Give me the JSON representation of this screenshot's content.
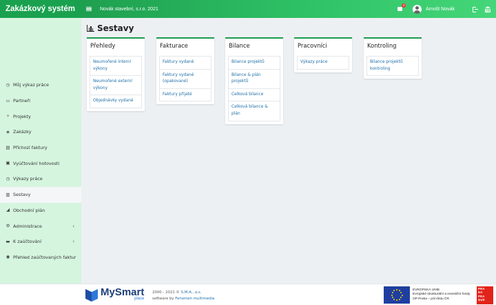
{
  "app": {
    "title": "Zakázkový systém",
    "company": "Novák stavební, s.r.o. 2021",
    "user": "Arnošt Novák",
    "notification_count": "4"
  },
  "colors": {
    "brand_green": "#1aa14f",
    "sidebar_bg": "#d5f5df",
    "link_blue": "#1e6fa8"
  },
  "icons": {
    "menu": "hamburger-icon",
    "notifications": "inbox-icon",
    "logout": "logout-icon",
    "home": "bank-icon"
  },
  "sidebar": {
    "items": [
      {
        "label": "Můj výkaz práce",
        "icon": "clock-icon",
        "glyph": "◷"
      },
      {
        "label": "Partneři",
        "icon": "id-card-icon",
        "glyph": "▭"
      },
      {
        "label": "Projekty",
        "icon": "sitemap-icon",
        "glyph": "⚬"
      },
      {
        "label": "Zakázky",
        "icon": "box-icon",
        "glyph": "◈"
      },
      {
        "label": "Příchozí faktury",
        "icon": "file-invoice-icon",
        "glyph": "▤"
      },
      {
        "label": "Vyúčtování hotovosti",
        "icon": "money-icon",
        "glyph": "▣"
      },
      {
        "label": "Výkazy práce",
        "icon": "clock-icon",
        "glyph": "◷"
      },
      {
        "label": "Sestavy",
        "icon": "bar-chart-icon",
        "glyph": "▥",
        "active": true
      },
      {
        "label": "Obchodní plán",
        "icon": "paper-plane-icon",
        "glyph": "◢"
      },
      {
        "label": "Administrace",
        "icon": "cogs-icon",
        "glyph": "⚙",
        "chevron": "‹"
      },
      {
        "label": "K zaúčtování",
        "icon": "folder-icon",
        "glyph": "▬",
        "chevron": "‹"
      },
      {
        "label": "Přehled zaúčtovaných faktur",
        "icon": "check-circle-icon",
        "glyph": "◉"
      }
    ]
  },
  "page": {
    "title": "Sestavy"
  },
  "cards": [
    {
      "title": "Přehledy",
      "links": [
        "Neumořené interní výkony",
        "Neumořené externí výkony",
        "Objednávky vydané"
      ]
    },
    {
      "title": "Fakturace",
      "links": [
        "Faktury vydané",
        "Faktury vydané (opakované)",
        "Faktury přijaté"
      ]
    },
    {
      "title": "Bilance",
      "links": [
        "Bilance projektů",
        "Bilance & plán projektů",
        "Celková bilance",
        "Celková bilance & plán"
      ]
    },
    {
      "title": "Pracovníci",
      "links": [
        "Výkazy práce"
      ]
    },
    {
      "title": "Kontroling",
      "links": [
        "Bilance projektů kontroling"
      ]
    }
  ],
  "footer": {
    "logo_main": "MySmart",
    "logo_sub": "place",
    "copyright": "2000 - 2021 © ",
    "copyright_link": "S.M.A., a.s.",
    "software_by": "software by ",
    "software_link": "Fenomen multimedia",
    "eu_line1": "EVROPSKÁ UNIE",
    "eu_line2": "Evropské strukturální a investiční fondy",
    "eu_line3": "OP Praha – pól růstu ČR",
    "praha_text": "PRAHA PRAGUE PRAGA PRAG"
  }
}
